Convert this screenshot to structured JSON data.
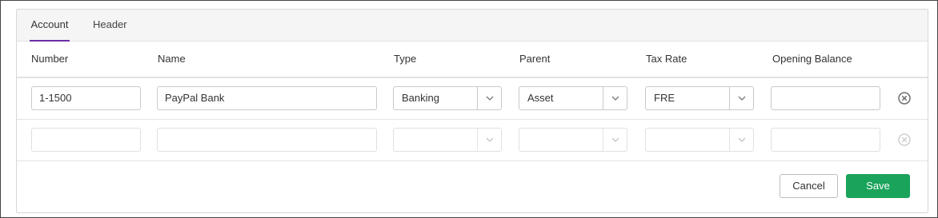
{
  "tabs": [
    {
      "label": "Account",
      "active": true
    },
    {
      "label": "Header",
      "active": false
    }
  ],
  "columns": {
    "number": "Number",
    "name": "Name",
    "type": "Type",
    "parent": "Parent",
    "tax_rate": "Tax Rate",
    "opening_balance": "Opening Balance"
  },
  "rows": [
    {
      "number": "1-1500",
      "name": "PayPal Bank",
      "type": "Banking",
      "parent": "Asset",
      "tax_rate": "FRE",
      "opening_balance": ""
    },
    {
      "number": "",
      "name": "",
      "type": "",
      "parent": "",
      "tax_rate": "",
      "opening_balance": ""
    }
  ],
  "icons": {
    "select_chevron": "chevron-down-icon",
    "remove_row": "close-circle-icon"
  },
  "buttons": {
    "cancel": "Cancel",
    "save": "Save"
  },
  "colors": {
    "active_tab": "#6b2fa3",
    "save_button": "#1aa35b"
  }
}
